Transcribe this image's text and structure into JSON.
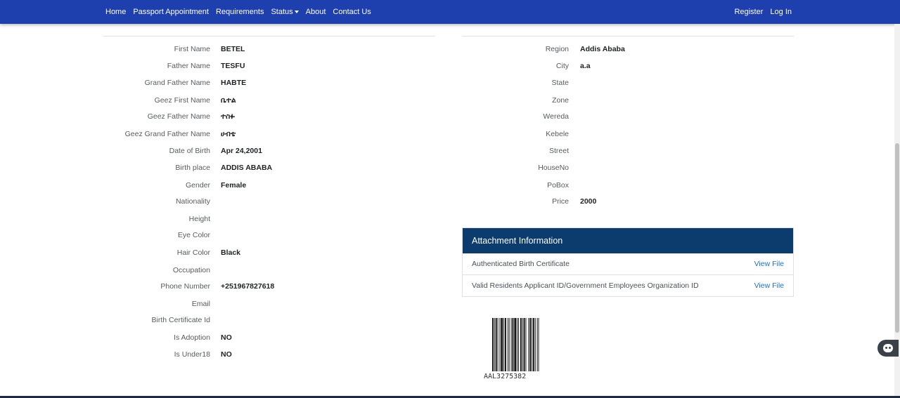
{
  "nav": {
    "home": "Home",
    "passport_appointment": "Passport Appointment",
    "requirements": "Requirements",
    "status": "Status",
    "about": "About",
    "contact_us": "Contact Us",
    "register": "Register",
    "login": "Log In"
  },
  "personal": [
    {
      "label": "First Name",
      "value": "BETEL"
    },
    {
      "label": "Father Name",
      "value": "TESFU"
    },
    {
      "label": "Grand Father Name",
      "value": "HABTE"
    },
    {
      "label": "Geez First Name",
      "value": "ቤተል"
    },
    {
      "label": "Geez Father Name",
      "value": "ተስፉ"
    },
    {
      "label": "Geez Grand Father Name",
      "value": "ሀብቴ"
    },
    {
      "label": "Date of Birth",
      "value": "Apr 24,2001"
    },
    {
      "label": "Birth place",
      "value": "ADDIS ABABA"
    },
    {
      "label": "Gender",
      "value": "Female"
    },
    {
      "label": "Nationality",
      "value": ""
    },
    {
      "label": "Height",
      "value": ""
    },
    {
      "label": "Eye Color",
      "value": ""
    },
    {
      "label": "Hair Color",
      "value": "Black"
    },
    {
      "label": "Occupation",
      "value": ""
    },
    {
      "label": "Phone Number",
      "value": "+251967827618"
    },
    {
      "label": "Email",
      "value": ""
    },
    {
      "label": "Birth Certificate Id",
      "value": ""
    },
    {
      "label": "Is Adoption",
      "value": "NO"
    },
    {
      "label": "Is Under18",
      "value": "NO"
    }
  ],
  "address": [
    {
      "label": "Region",
      "value": "Addis Ababa"
    },
    {
      "label": "City",
      "value": "a.a"
    },
    {
      "label": "State",
      "value": ""
    },
    {
      "label": "Zone",
      "value": ""
    },
    {
      "label": "Wereda",
      "value": ""
    },
    {
      "label": "Kebele",
      "value": ""
    },
    {
      "label": "Street",
      "value": ""
    },
    {
      "label": "HouseNo",
      "value": ""
    },
    {
      "label": "PoBox",
      "value": ""
    },
    {
      "label": "Price",
      "value": "2000"
    }
  ],
  "attachments": {
    "title": "Attachment Information",
    "items": [
      {
        "name": "Authenticated Birth Certificate",
        "link": "View File"
      },
      {
        "name": "Valid Residents Applicant ID/Government Employees Organization ID",
        "link": "View File"
      }
    ]
  },
  "barcode": {
    "text": "AAL3275382"
  },
  "colors": {
    "navbar": "#1e3fae",
    "attach_header": "#0c3b6e",
    "link": "#1a6fd6"
  }
}
